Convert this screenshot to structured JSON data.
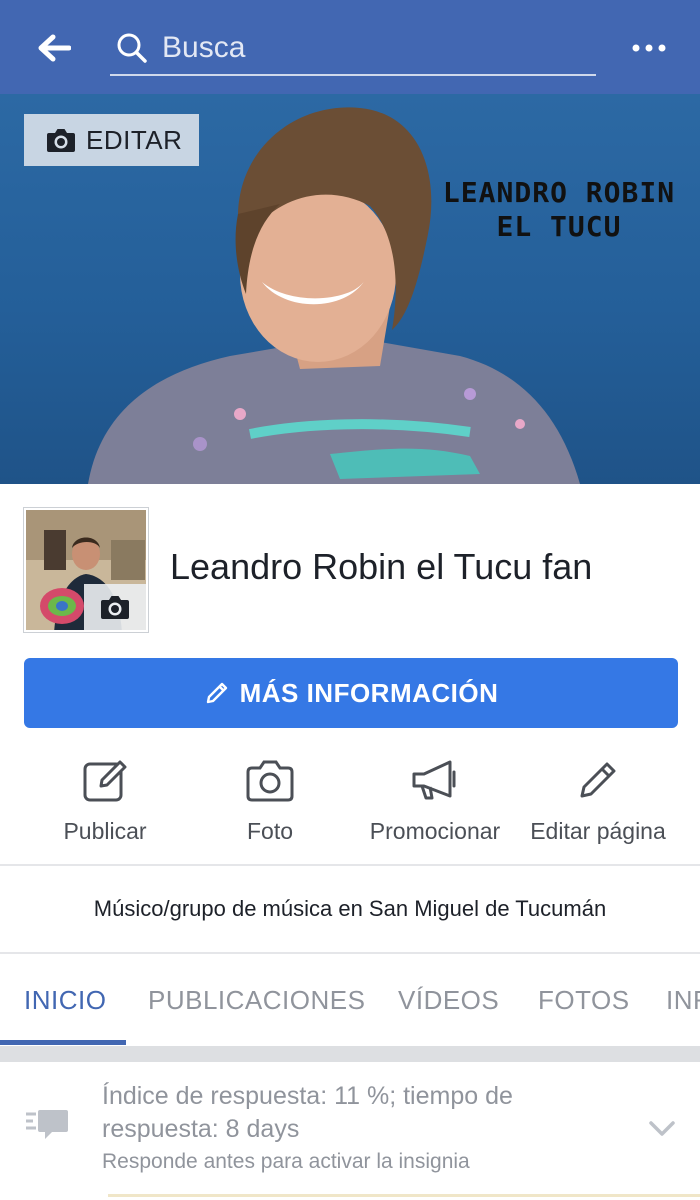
{
  "header": {
    "search_placeholder": "Busca",
    "back_icon": "arrow-left-icon",
    "more_icon": "more-dots-icon",
    "background_color": "#4267b2"
  },
  "cover": {
    "edit_label": "EDITAR",
    "title_line1": "LEANDRO ROBIN",
    "title_line2": "EL TUCU"
  },
  "page": {
    "name": "Leandro Robin el Tucu fan",
    "category": "Músico/grupo de música en San Miguel de Tucumán"
  },
  "more_info_button": {
    "label": "MÁS INFORMACIÓN",
    "color": "#3578e5"
  },
  "actions": [
    {
      "label": "Publicar",
      "icon": "compose-icon"
    },
    {
      "label": "Foto",
      "icon": "camera-icon"
    },
    {
      "label": "Promocionar",
      "icon": "megaphone-icon"
    },
    {
      "label": "Editar página",
      "icon": "pencil-icon"
    }
  ],
  "tabs": [
    {
      "label": "INICIO",
      "active": true
    },
    {
      "label": "PUBLICACIONES",
      "active": false
    },
    {
      "label": "VÍDEOS",
      "active": false
    },
    {
      "label": "FOTOS",
      "active": false
    },
    {
      "label": "INF",
      "active": false
    }
  ],
  "response": {
    "text": "Índice de respuesta: 11 %; tiempo de respuesta: 8 days",
    "subtext": "Responde antes para activar la insignia"
  }
}
